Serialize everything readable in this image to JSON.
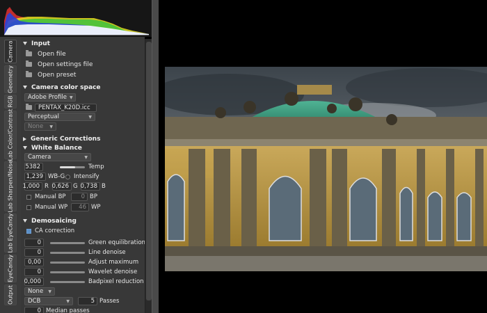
{
  "tabs": [
    "Camera",
    "Geometry",
    "RGB",
    "Lab Color/Contrast",
    "Lab Sharpen/Noise",
    "Lab EyeCandy",
    "EyeCandy",
    "Output"
  ],
  "input": {
    "title": "Input",
    "open_file": "Open file",
    "open_settings": "Open settings file",
    "open_preset": "Open preset"
  },
  "camera_color_space": {
    "title": "Camera color space",
    "profile": "Adobe Profile",
    "icc": "PENTAX_K20D.icc",
    "intent": "Perceptual",
    "lut": "None"
  },
  "generic_corrections": {
    "title": "Generic Corrections"
  },
  "white_balance": {
    "title": "White Balance",
    "mode": "Camera",
    "temp_value": "5382",
    "temp_label": "Temp",
    "temp_level": 0.6,
    "wbg_value": "1,239",
    "wbg_label": "WB-G",
    "intensify": "Intensify",
    "r_value": "1,000",
    "r_label": "R",
    "g_value": "0,626",
    "g_label": "G",
    "b_value": "0,738",
    "b_label": "B",
    "manual_bp": "Manual BP",
    "bp_value": "0",
    "bp_label": "BP",
    "manual_wp": "Manual WP",
    "wp_value": "46",
    "wp_label": "WP"
  },
  "demosaicing": {
    "title": "Demosaicing",
    "ca_correction": "CA correction",
    "green_value": "0",
    "green_label": "Green equilibration",
    "line_value": "0",
    "line_label": "Line denoise",
    "adjust_value": "0,00",
    "adjust_label": "Adjust maximum",
    "wavelet_value": "0",
    "wavelet_label": "Wavelet denoise",
    "badpixel_value": "0,000",
    "badpixel_label": "Badpixel reduction",
    "filter": "None",
    "method": "DCB",
    "passes_value": "5",
    "passes_label": "Passes",
    "median_value": "0",
    "median_label": "Median passes"
  },
  "colors": {
    "panel": "#383838",
    "accent": "#5b8fc7"
  }
}
